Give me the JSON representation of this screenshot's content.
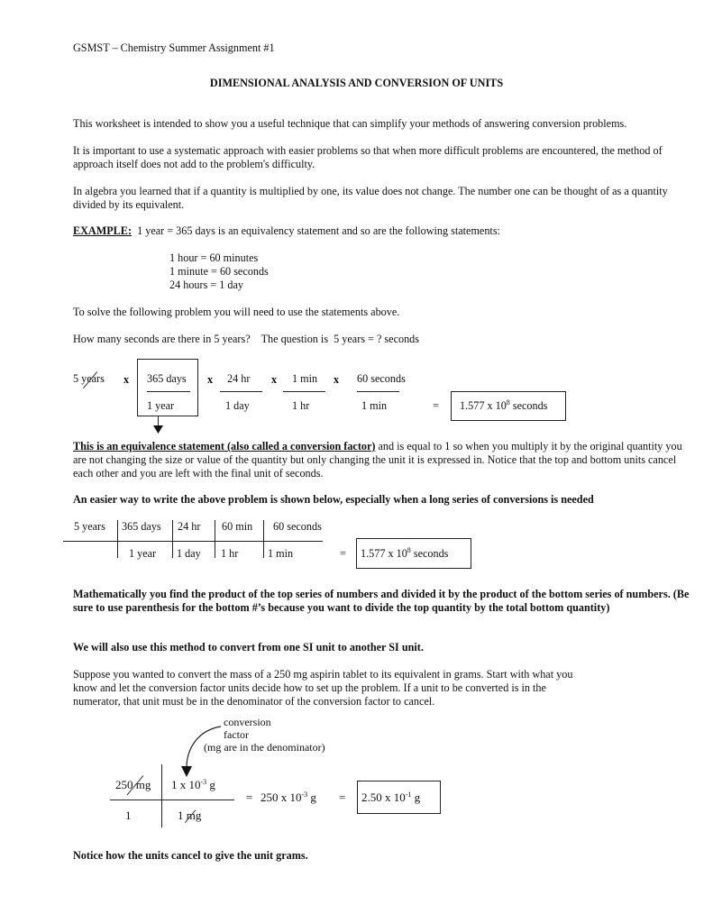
{
  "header": "GSMST – Chemistry Summer Assignment #1",
  "title": "DIMENSIONAL ANALYSIS AND CONVERSION OF UNITS",
  "intro": {
    "p1": "This worksheet is intended to show you a useful technique that can simplify your methods of answering conversion problems.",
    "p2": " It is important to use a systematic approach with easier problems so that when more difficult problems are encountered, the method of approach itself does not add to the problem's difficulty.",
    "p3": " In algebra you learned that if a quantity is multiplied by one, its value does not change. The number one can be thought of as a quantity divided by its equivalent."
  },
  "example": {
    "label": "EXAMPLE:",
    "text": "  1 year = 365 days is an equivalency statement and so are the following statements:",
    "statements": [
      "1 hour = 60 minutes",
      "1 minute = 60 seconds",
      "24 hours = 1 day"
    ],
    "instruction": "To solve the following problem you will need to use the statements above.",
    "question": "How many seconds are there in 5 years?    The question is  5 years = ? seconds"
  },
  "equation1": {
    "start": "5 years",
    "times": "x",
    "equals": "=",
    "factors": [
      {
        "num": "365 days",
        "den": "1 year"
      },
      {
        "num": "24 hr",
        "den": "1 day"
      },
      {
        "num": "1 min",
        "den": "1 hr"
      },
      {
        "num": "60 seconds",
        "den": "1 min"
      }
    ],
    "result_mantissa": "1.577 x 10",
    "result_exp": "8",
    "result_unit": " seconds"
  },
  "explanation": {
    "underlined": "This is an equivalence statement (also called a conversion factor)",
    "rest": " and is equal to 1 so when you multiply it by the original quantity you are not changing the size or value of the quantity but only changing the unit it is expressed in.  Notice that the top and bottom units cancel each other and you are left with the final unit of seconds.",
    "easier": "An easier way to write the above problem is shown below, especially when a long series of conversions is needed"
  },
  "grid1": {
    "top": [
      "5 years",
      "365 days",
      "24 hr",
      "60 min",
      "60 seconds"
    ],
    "bottom": [
      "",
      "1 year",
      "1 day",
      "1 hr",
      "1 min"
    ],
    "equals": "=",
    "result_mantissa": "1.577 x 10",
    "result_exp": "8",
    "result_unit": " seconds"
  },
  "math_note": "Mathematically you find the product of the top series of numbers and divided it by the product of the bottom series of numbers.  (Be sure to use parenthesis for the bottom #’s because you want to divide the top quantity by the total bottom quantity)",
  "si_note": "We will also use this method to convert from one SI unit to another SI unit.",
  "aspirin": "Suppose you wanted to convert the mass of a 250 mg aspirin tablet to its equivalent in grams. Start with what you know and let the conversion factor units decide how to set up the problem. If a unit to be converted is in the numerator, that unit must be in the denominator of the conversion factor to cancel.",
  "grid2": {
    "annotation": [
      "conversion",
      "factor",
      "(mg are in the denominator)"
    ],
    "top_left": "250 mg",
    "top_right_mantissa": "1 x 10",
    "top_right_exp": "-3",
    "top_right_unit": " g",
    "bottom_left": "1",
    "bottom_right": "1 mg",
    "equals": "=",
    "mid_mantissa": "250 x 10",
    "mid_exp": "-3",
    "mid_unit": " g",
    "result_mantissa": "2.50 x 10",
    "result_exp": "-1",
    "result_unit": " g"
  },
  "closing": "Notice how the units cancel to give the unit grams."
}
